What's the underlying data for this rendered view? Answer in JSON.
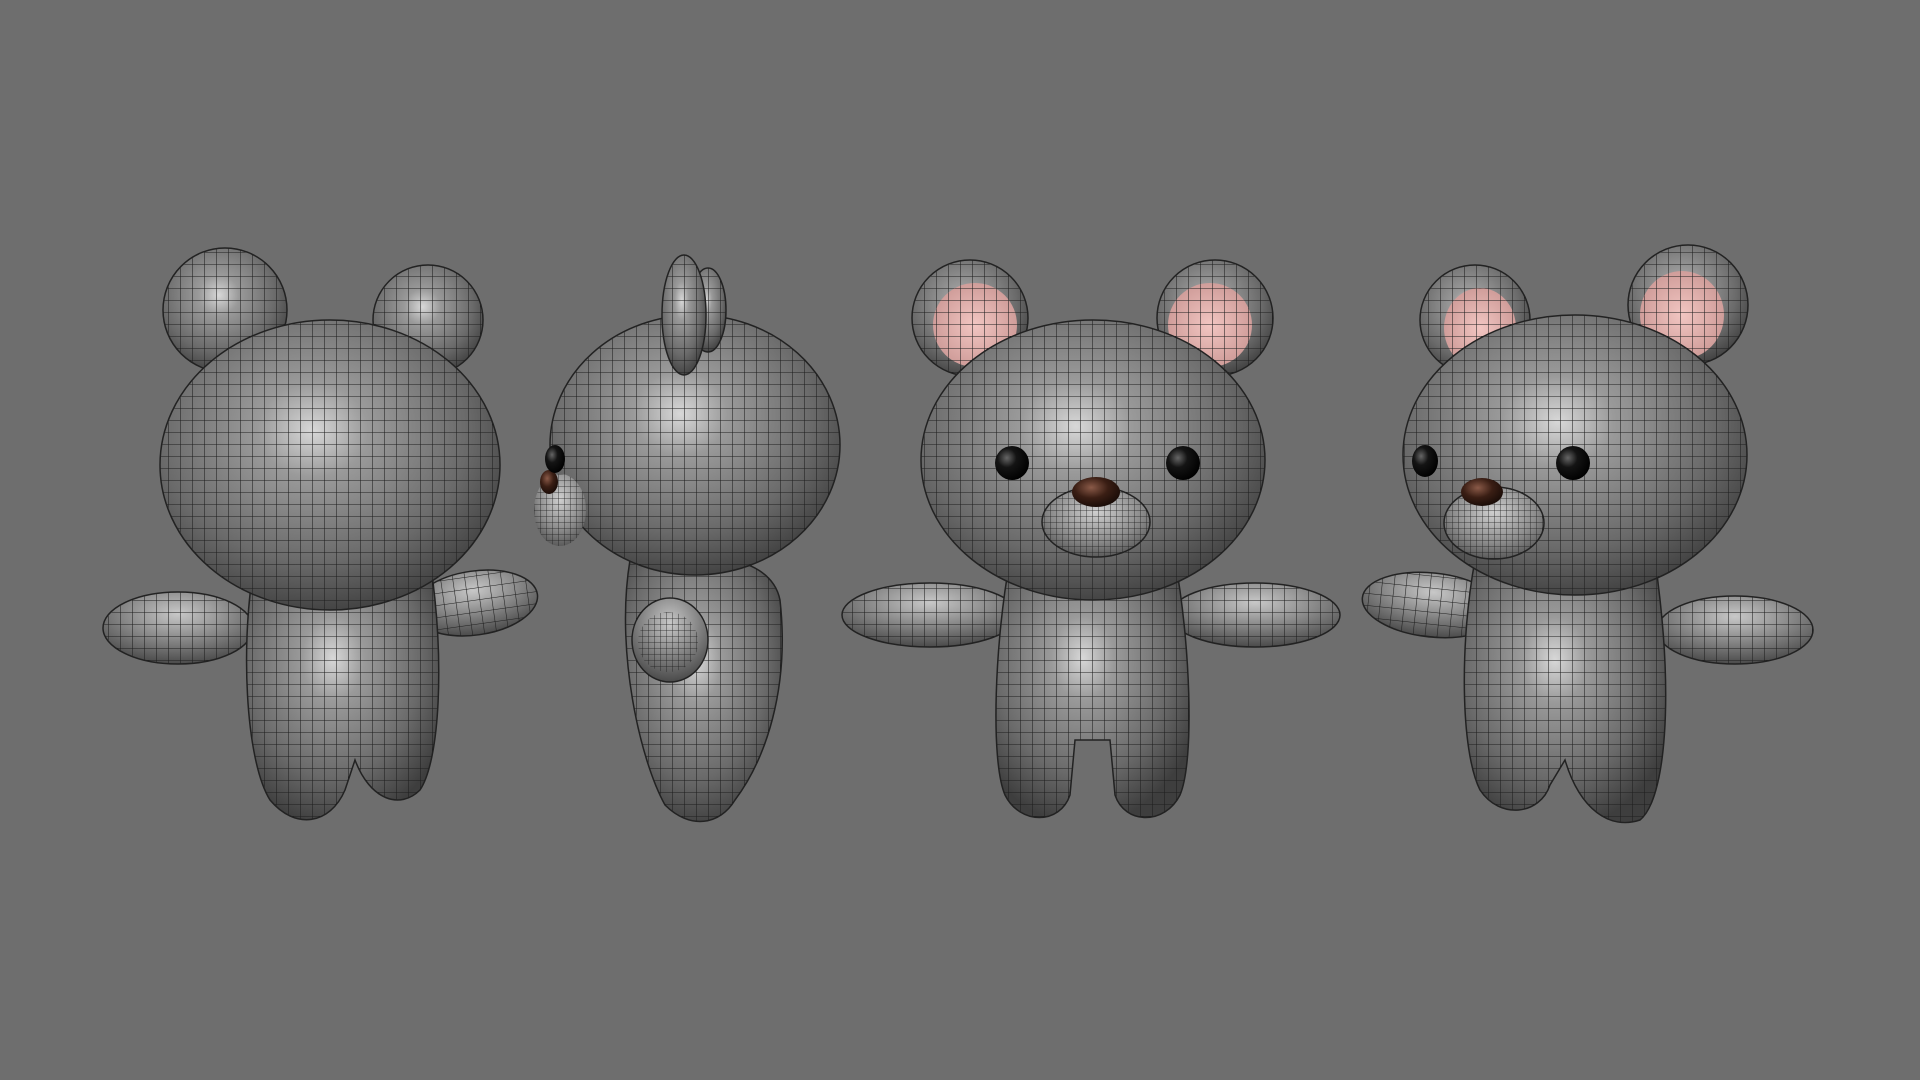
{
  "scene": {
    "background_color": "#6e6e6e",
    "model_color": "#8a8a8a",
    "wire_color": "#1e1e1e",
    "inner_ear_color": "#e8b3b0",
    "eye_color": "#111111",
    "nose_color": "#3a1e14",
    "views": [
      {
        "name": "back"
      },
      {
        "name": "side"
      },
      {
        "name": "front"
      },
      {
        "name": "three-quarter"
      }
    ]
  }
}
